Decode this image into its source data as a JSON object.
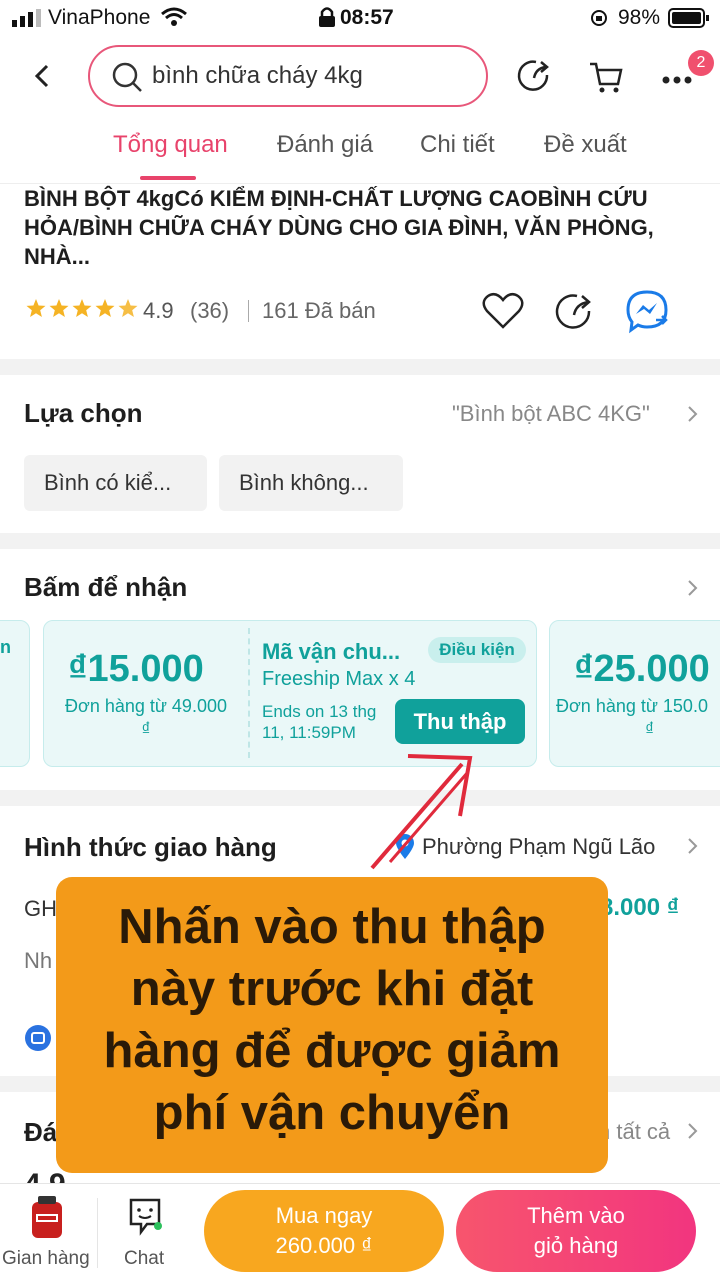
{
  "status": {
    "carrier": "VinaPhone",
    "time": "08:57",
    "battery": "98%"
  },
  "header": {
    "search_value": "bình chữa cháy 4kg",
    "cart_badge": "2"
  },
  "tabs": [
    "Tổng quan",
    "Đánh giá",
    "Chi tiết",
    "Đề xuất"
  ],
  "product": {
    "title": "BÌNH BỘT 4kgCó KIỂM ĐỊNH-CHẤT LƯỢNG CAOBÌNH CỨU HỎA/BÌNH CHỮA CHÁY DÙNG CHO GIA ĐÌNH, VĂN PHÒNG, NHÀ...",
    "rating": "4.9",
    "reviews": "(36)",
    "sold": "161 Đã bán"
  },
  "options": {
    "title": "Lựa chọn",
    "selected": "\"Bình bột ABC 4KG\"",
    "chips": [
      "Bình có kiể...",
      "Bình không..."
    ]
  },
  "coupons": {
    "title": "Bấm để nhận",
    "left_partial": "n",
    "c1": {
      "value": "₫15.000",
      "sub1": "Đơn hàng từ 49.000",
      "sub2": "₫"
    },
    "c2": {
      "title": "Mã vận chu...",
      "condition": "Điều kiện",
      "desc": "Freeship Max x 4",
      "ends1": "Ends on 13 thg",
      "ends2": "11, 11:59PM",
      "button": "Thu thập"
    },
    "c3": {
      "value": "₫25.000",
      "sub1": "Đơn hàng từ 150.0",
      "sub2": "₫"
    }
  },
  "shipping": {
    "title": "Hình thức giao hàng",
    "location": "Phường Phạm Ngũ Lão",
    "row1_left": "GH",
    "row1_right": "8.000 ₫",
    "row2_left": "Nh"
  },
  "reviews_section": {
    "title": "Đánh g",
    "see_all": "Xem tất cả",
    "partial": "4.9"
  },
  "callout": {
    "lines": [
      "Nhấn vào thu thập",
      "này trước khi đặt",
      "hàng để được giảm",
      "phí vận chuyển"
    ]
  },
  "bottom": {
    "shop": "Gian hàng",
    "chat": "Chat",
    "buy_line1": "Mua ngay",
    "buy_line2": "260.000 ₫",
    "cart_line1": "Thêm vào",
    "cart_line2": "giỏ hàng"
  },
  "colors": {
    "accent": "#e8436b",
    "teal": "#10a19b",
    "callout": "#f39a19"
  }
}
